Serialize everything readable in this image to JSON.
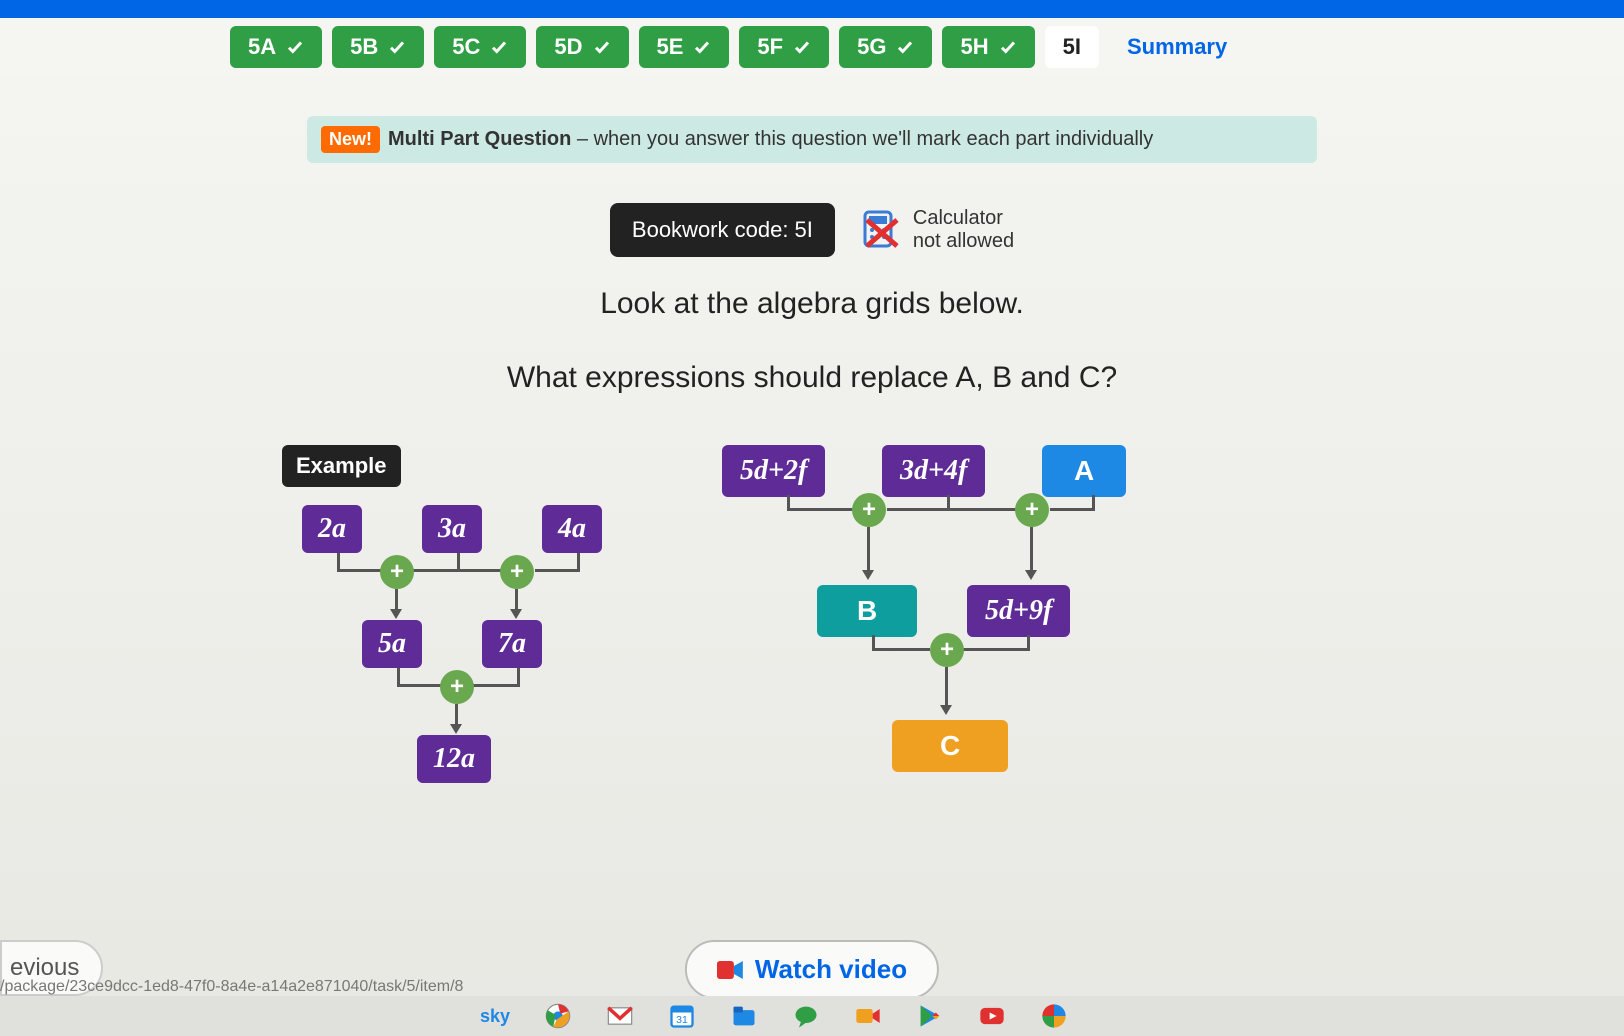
{
  "nav": {
    "items": [
      {
        "label": "5A",
        "done": true
      },
      {
        "label": "5B",
        "done": true
      },
      {
        "label": "5C",
        "done": true
      },
      {
        "label": "5D",
        "done": true
      },
      {
        "label": "5E",
        "done": true
      },
      {
        "label": "5F",
        "done": true
      },
      {
        "label": "5G",
        "done": true
      },
      {
        "label": "5H",
        "done": true
      },
      {
        "label": "5I",
        "done": false
      }
    ],
    "summary": "Summary"
  },
  "banner": {
    "badge": "New!",
    "strong": "Multi Part Question",
    "rest": " – when you answer this question we'll mark each part individually"
  },
  "meta": {
    "bookwork": "Bookwork code: 5I",
    "calc_line1": "Calculator",
    "calc_line2": "not allowed"
  },
  "question": {
    "line1": "Look at the algebra grids below.",
    "line2": "What expressions should replace A, B and C?"
  },
  "example_label": "Example",
  "grid_left": {
    "top": [
      "2a",
      "3a",
      "4a"
    ],
    "mid": [
      "5a",
      "7a"
    ],
    "bottom": "12a"
  },
  "grid_right": {
    "top": [
      "5d+2f",
      "3d+4f",
      "A"
    ],
    "mid": [
      "B",
      "5d+9f"
    ],
    "bottom": "C"
  },
  "plus": "+",
  "watch_video": "Watch video",
  "previous": "evious",
  "url": "/package/23ce9dcc-1ed8-47f0-8a4e-a14a2e871040/task/5/item/8",
  "taskbar": {
    "sky": "sky"
  }
}
